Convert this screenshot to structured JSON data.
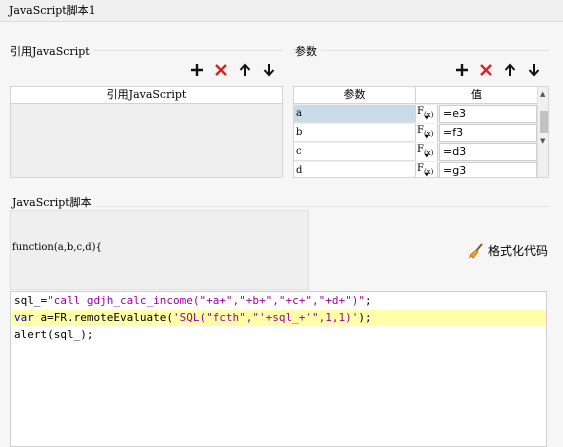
{
  "window": {
    "title": "JavaScript脚本1"
  },
  "left_panel": {
    "section_title": "引用JavaScript",
    "list_header": "引用JavaScript",
    "items": []
  },
  "params_panel": {
    "section_title": "参数",
    "headers": {
      "name": "参数",
      "value": "值"
    },
    "fx_label": "F",
    "fx_sub": "(x)",
    "fx_arrow": "▼",
    "rows": [
      {
        "name": "a",
        "value": "=e3"
      },
      {
        "name": "b",
        "value": "=f3"
      },
      {
        "name": "c",
        "value": "=d3"
      },
      {
        "name": "d",
        "value": "=g3"
      }
    ]
  },
  "toolbar_icons": [
    "plus-icon",
    "delete-x-icon",
    "arrow-up-icon",
    "arrow-down-icon"
  ],
  "script_panel": {
    "section_title": "JavaScript脚本",
    "function_signature": "function(a,b,c,d){",
    "format_button_label": "格式化代码",
    "code": {
      "line1": {
        "a": "sql_=",
        "b": "\"call gdjh_calc_income(\"+a+\",\"+b+\",\"+c+\",\"+d+\")\"",
        "c": ";"
      },
      "line2": {
        "a": "var",
        "b": " a=FR.remoteEvaluate(",
        "c": "'SQL(\"fcth\",\"'+sql_+'\",1,1)'",
        "d": ");"
      },
      "line3": "alert(sql_);"
    }
  },
  "colors": {
    "selected_row": "#c9dbe8",
    "highlight_line": "#ffffaa",
    "delete_red": "#e02020",
    "string_purple": "#a000a0",
    "keyword_blue": "#0000c8"
  }
}
